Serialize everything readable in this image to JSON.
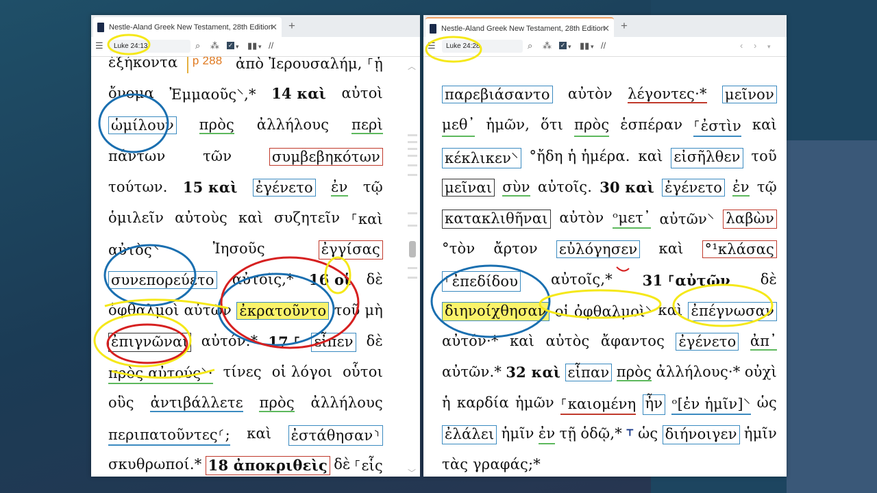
{
  "left": {
    "tab_title": "Nestle-Aland Greek New Testament, 28th Edition",
    "reference": "Luke 24:13",
    "lines": [
      [
        "ἑξήκοντα",
        "p 288",
        "ἀπὸ Ἰερουσαλήμ, ⸀ᾗ"
      ],
      [
        "ὄνομα",
        "Ἐμμαοῦς⸌,*",
        "14 καὶ",
        "αὐτοὶ"
      ],
      [
        "ὡμίλουν",
        "πρὸς",
        "ἀλλήλους",
        "περὶ"
      ],
      [
        "πάντων",
        "τῶν",
        "συμβεβηκότων"
      ],
      [
        "τούτων.",
        "15 καὶ",
        "ἐγένετο",
        "ἐν",
        "τῷ"
      ],
      [
        "ὁμιλεῖν",
        "αὐτοὺς",
        "καὶ",
        "συζητεῖν",
        "⸀καὶ"
      ],
      [
        "αὐτὸς⸌",
        "Ἰησοῦς",
        "ἐγγίσας"
      ],
      [
        "συνεπορεύετο",
        "αὐτοῖς,*",
        "16 οἱ",
        "δὲ"
      ],
      [
        "ὀφθαλμοὶ αὐτῶν",
        "ἐκρατοῦντο",
        "τοῦ μὴ"
      ],
      [
        "ἐπιγνῶναι",
        "αὐτόν.*",
        "17 ⸀",
        "εἶπεν",
        "δὲ"
      ],
      [
        "πρὸς αὐτούς⸌·",
        "τίνες",
        "οἱ λόγοι",
        "οὗτοι"
      ],
      [
        "οὓς",
        "ἀντιβάλλετε",
        "πρὸς",
        "ἀλλήλους"
      ],
      [
        "περιπατοῦντες⸂;",
        "καὶ",
        "ἐστάθησαν⸃"
      ],
      [
        "σκυθρωποί.*",
        "18 ἀποκριθεὶς",
        "δὲ",
        "⸀εἷς"
      ]
    ]
  },
  "right": {
    "tab_title": "Nestle-Aland Greek New Testament, 28th Edition",
    "reference": "Luke 24:28",
    "lines": [
      [
        "παρεβιάσαντο",
        "αὐτὸν",
        "λέγοντες·*",
        "μεῖνον"
      ],
      [
        "μεθ᾽",
        "ἡμῶν,",
        "ὅτι",
        "πρὸς",
        "ἑσπέραν",
        "⸀ἐστὶν",
        "καὶ"
      ],
      [
        "κέκλικεν⸌",
        "°ἤδη ἡ ἡμέρα.",
        "καὶ",
        "εἰσῆλθεν",
        "τοῦ"
      ],
      [
        "μεῖναι",
        "σὺν",
        "αὐτοῖς.",
        "30 καὶ",
        "ἐγένετο",
        "ἐν",
        "τῷ"
      ],
      [
        "κατακλιθῆναι",
        "αὐτὸν",
        "ᵒμετ᾽",
        "αὐτῶν⸌",
        "λαβὼν"
      ],
      [
        "°τὸν",
        "ἄρτον",
        "εὐλόγησεν",
        "καὶ",
        "°¹κλάσας"
      ],
      [
        "⸀ἐπεδίδου",
        "αὐτοῖς,*",
        "31 ⸀αὐτῶν",
        "δὲ"
      ],
      [
        "διηνοίχθησαν",
        "οἱ ὀφθαλμοὶ⸌",
        "καὶ",
        "ἐπέγνωσαν"
      ],
      [
        "αὐτόν·*",
        "καὶ",
        "αὐτὸς",
        "ἄφαντος",
        "ἐγένετο",
        "ἀπ᾽"
      ],
      [
        "αὐτῶν.*",
        "32 καὶ",
        "εἶπαν",
        "πρὸς",
        "ἀλλήλους·*",
        "οὐχὶ"
      ],
      [
        "ἡ",
        "καρδία",
        "ἡμῶν",
        "⸀καιομένη",
        "ἦν",
        "ᵒ[ἐν ἡμῖν]⸌",
        "ὡς"
      ],
      [
        "ἐλάλει",
        "ἡμῖν",
        "ἐν",
        "τῇ",
        "ὁδῷ,*",
        "⸆",
        "ὡς",
        "διήνοιγεν",
        "ἡμῖν"
      ],
      [
        "τὰς γραφάς;*"
      ]
    ]
  },
  "colors": {
    "highlight": "#fbf36a",
    "annotation_yellow": "#f5e81a",
    "annotation_blue": "#1a6fb0",
    "annotation_red": "#d62020"
  }
}
